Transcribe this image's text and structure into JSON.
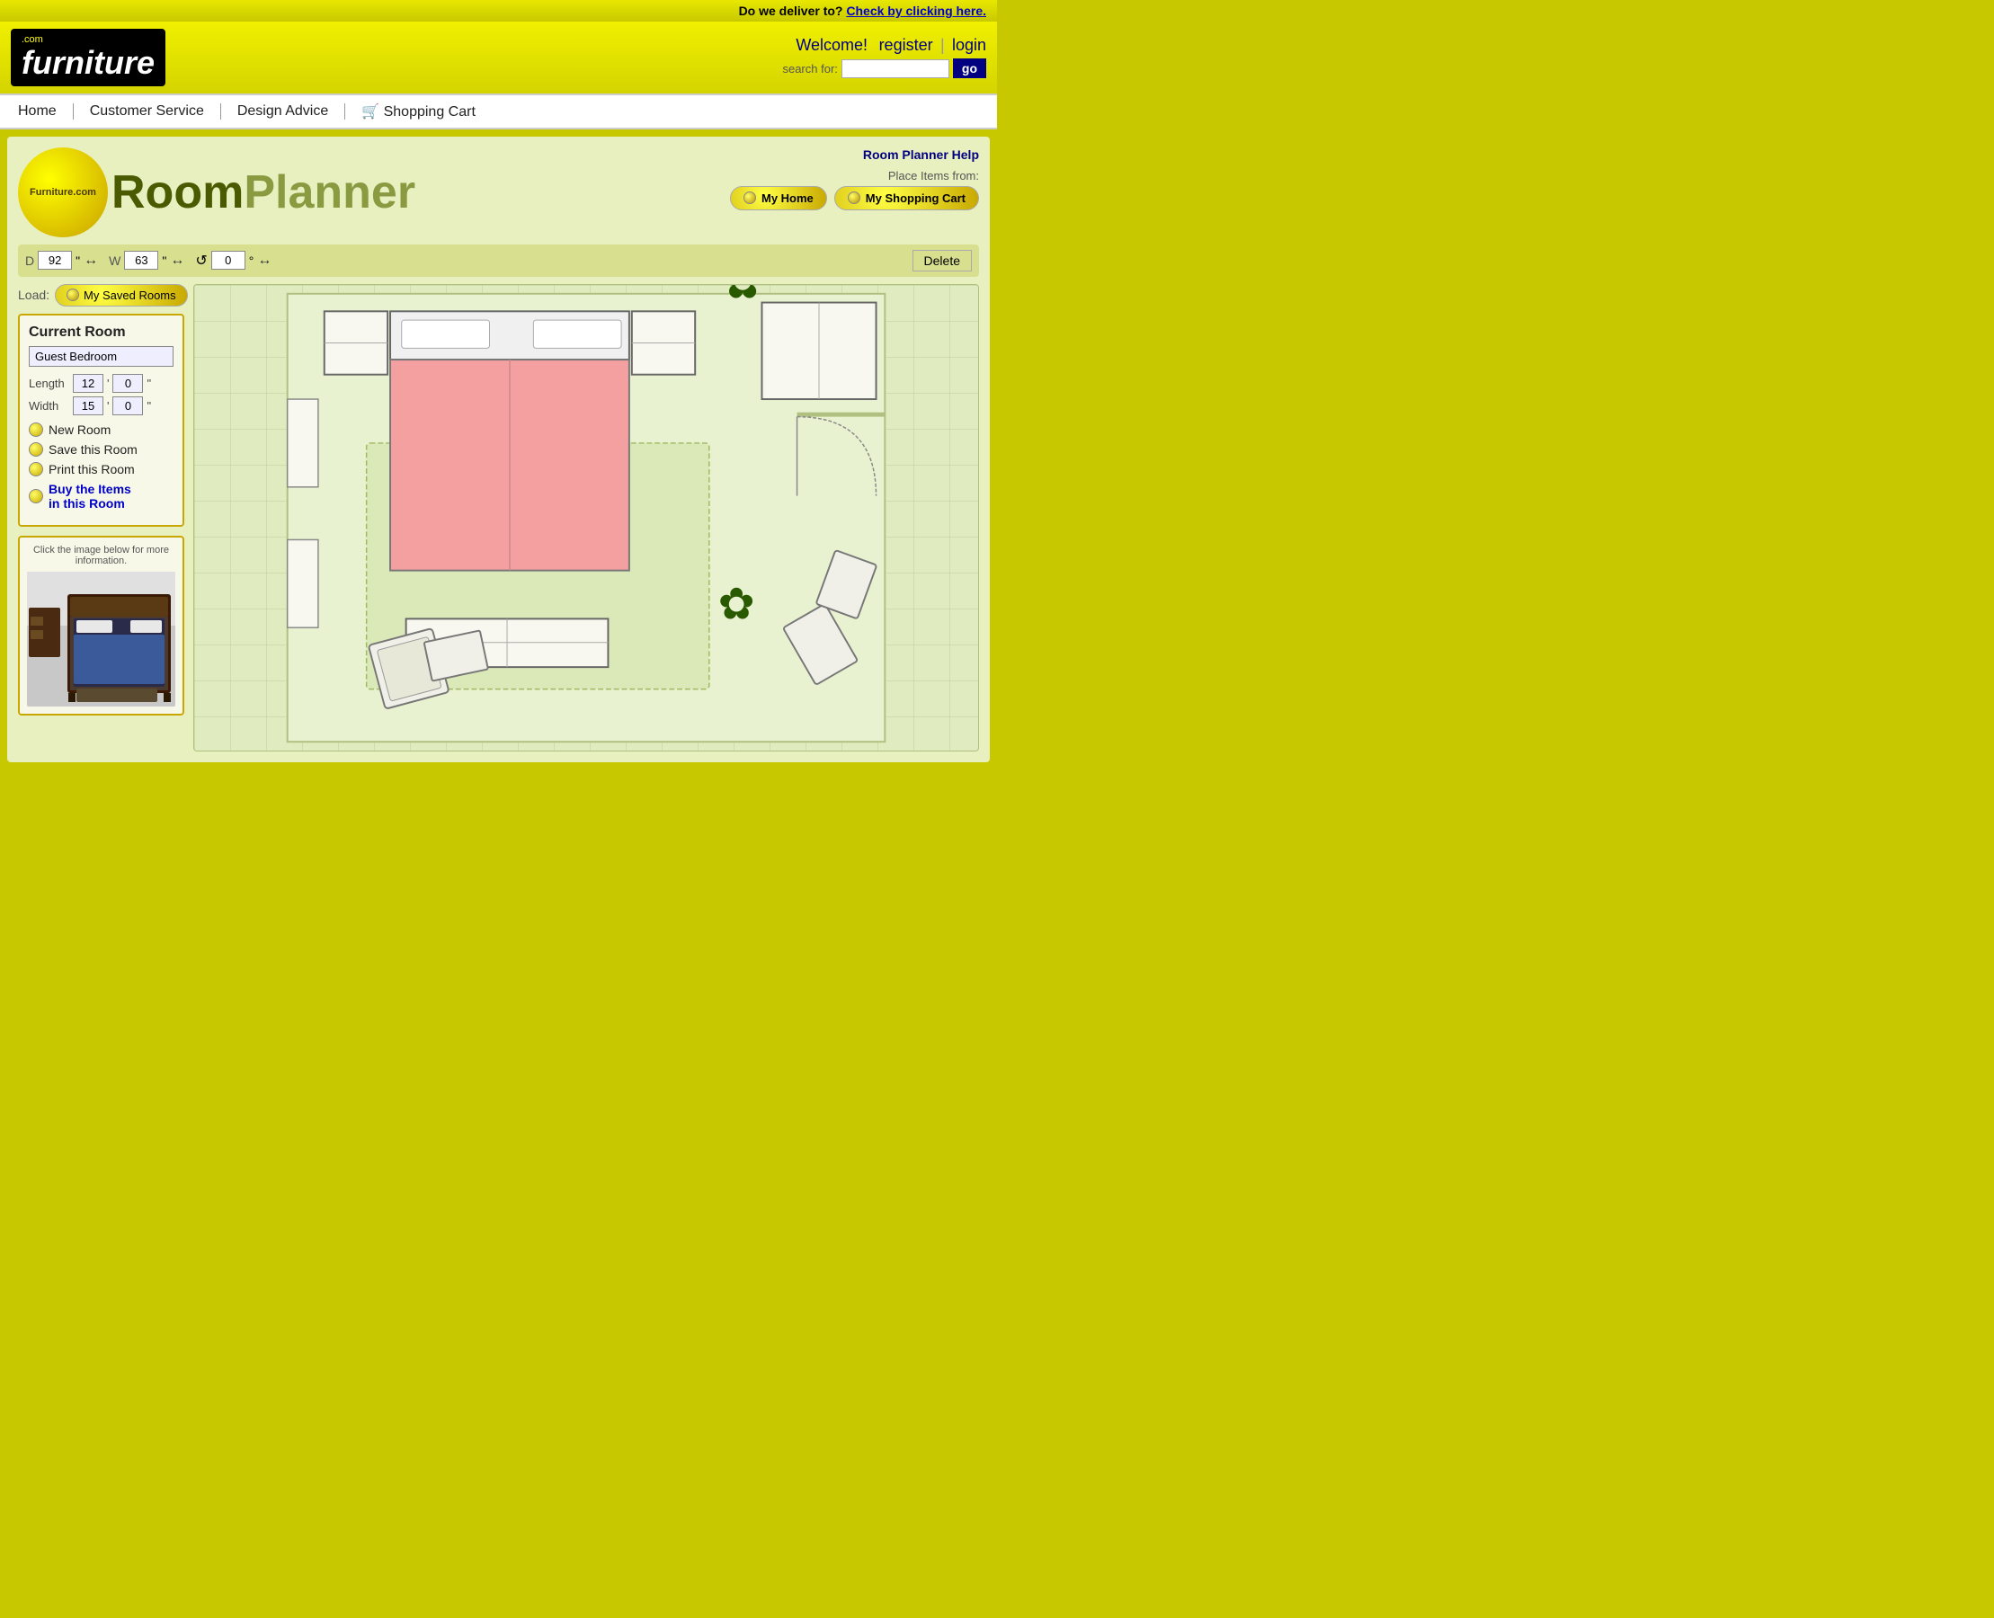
{
  "delivery_bar": {
    "text": "Do we deliver to?",
    "link": "Check by clicking here."
  },
  "header": {
    "logo_main": "furniture",
    "logo_com": ".com",
    "welcome": "Welcome!",
    "register": "register",
    "separator": "|",
    "login": "login",
    "search_label": "search for:",
    "search_placeholder": "",
    "go_button": "go"
  },
  "navbar": {
    "items": [
      {
        "label": "Home"
      },
      {
        "label": "Customer Service"
      },
      {
        "label": "Design Advice"
      },
      {
        "label": "Shopping Cart"
      }
    ]
  },
  "planner": {
    "logo_site": "Furniture.com",
    "logo_room": "Room",
    "logo_planner": "Planner",
    "help_link": "Room Planner Help",
    "place_items_label": "Place Items from:",
    "my_home_btn": "My Home",
    "my_shopping_cart_btn": "My Shopping Cart",
    "controls": {
      "d_label": "D",
      "d_value": "92",
      "d_unit": "\"",
      "w_label": "W",
      "w_value": "63",
      "w_unit": "\"",
      "rotate_value": "0",
      "rotate_unit": "°",
      "delete_label": "Delete"
    },
    "load_label": "Load:",
    "saved_rooms_btn": "My Saved Rooms",
    "current_room": {
      "title": "Current Room",
      "name": "Guest Bedroom",
      "length_label": "Length",
      "length_ft": "12",
      "length_in": "0",
      "width_label": "Width",
      "width_ft": "15",
      "width_in": "0"
    },
    "actions": {
      "new_room": "New Room",
      "save_room": "Save this Room",
      "print_room": "Print this Room",
      "buy_items": "Buy the Items\nin this Room"
    },
    "preview": {
      "note": "Click the image below for more information."
    }
  }
}
